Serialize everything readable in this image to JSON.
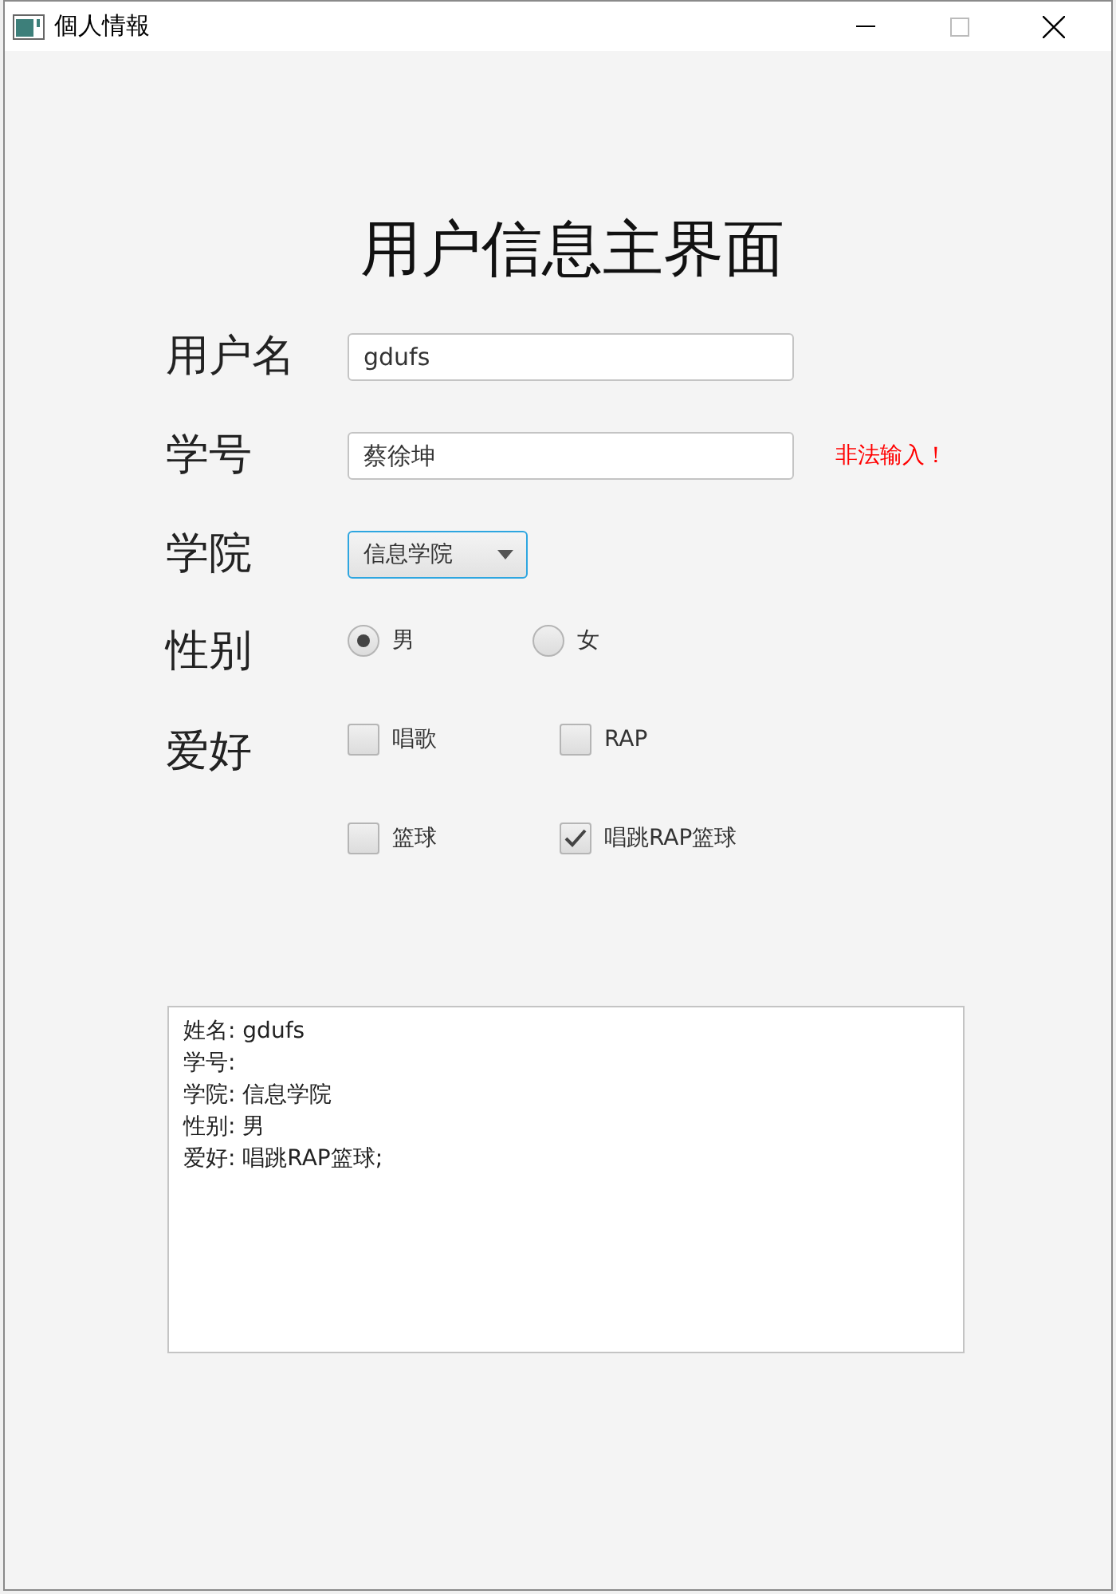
{
  "window": {
    "title": "個人情報"
  },
  "heading": "用户信息主界面",
  "fields": [
    {
      "kind": "text",
      "label": "用户名",
      "value": "gdufs"
    },
    {
      "kind": "text",
      "label": "学号",
      "value": "蔡徐坤",
      "error": "非法输入！"
    },
    {
      "kind": "combo",
      "label": "学院",
      "value": "信息学院"
    },
    {
      "kind": "radio",
      "label": "性别",
      "options": [
        {
          "label": "男",
          "selected": true
        },
        {
          "label": "女",
          "selected": false
        }
      ]
    },
    {
      "kind": "checkbox",
      "label": "爱好",
      "options": [
        {
          "label": "唱歌",
          "checked": false
        },
        {
          "label": "RAP",
          "checked": false
        },
        {
          "label": "篮球",
          "checked": false
        },
        {
          "label": "唱跳RAP篮球",
          "checked": true
        }
      ]
    }
  ],
  "output": {
    "lines": [
      "姓名: gdufs",
      "学号:",
      "学院: 信息学院",
      "性别: 男",
      "爱好: 唱跳RAP篮球;"
    ]
  }
}
